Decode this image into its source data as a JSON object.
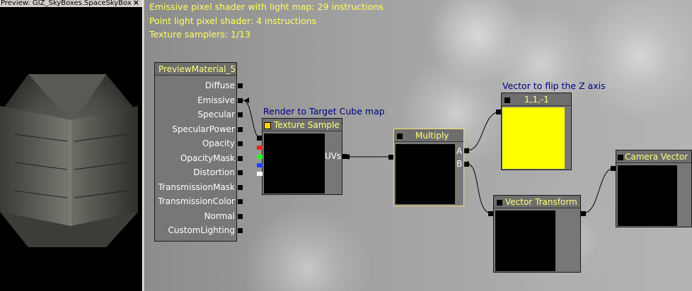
{
  "preview": {
    "title": "Preview: GIZ_SkyBoxes.SpaceSkyBox",
    "close_glyph": "×"
  },
  "stats": [
    "Emissive pixel shader with light map: 29 instructions",
    "Point light pixel shader: 4 instructions",
    "Texture samplers: 1/13"
  ],
  "material_node": {
    "title": "PreviewMaterial_5",
    "inputs": [
      "Diffuse",
      "Emissive",
      "Specular",
      "SpecularPower",
      "Opacity",
      "OpacityMask",
      "Distortion",
      "TransmissionMask",
      "TransmissionColor",
      "Normal",
      "CustomLighting"
    ]
  },
  "texture_sample": {
    "comment": "Render to Target Cube map",
    "title": "Texture Sample",
    "input_label": "UVs",
    "channel_colors": [
      "#ff2020",
      "#20ff20",
      "#2040ff",
      "#ffffff"
    ]
  },
  "multiply": {
    "title": "Multiply",
    "input_a": "A",
    "input_b": "B"
  },
  "vector_const": {
    "comment": "Vector to flip the Z axis",
    "title": "1,1,-1",
    "color": "#ffff00"
  },
  "vector_transform": {
    "title": "Vector Transform"
  },
  "camera_vector": {
    "title": "Camera Vector"
  }
}
